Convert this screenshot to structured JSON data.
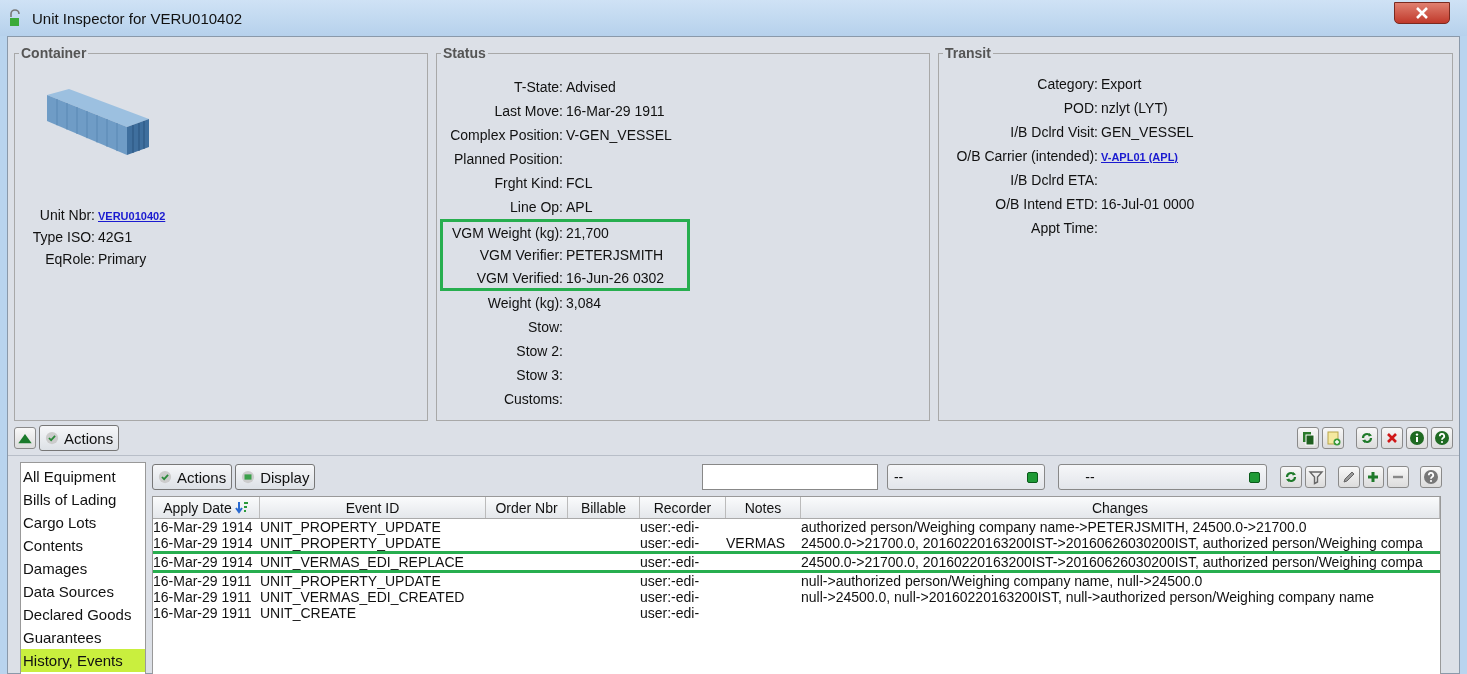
{
  "window": {
    "title": "Unit Inspector for VERU010402"
  },
  "container": {
    "title": "Container",
    "fields": [
      {
        "label": "Unit Nbr:",
        "value": "VERU010402",
        "kind": "link"
      },
      {
        "label": "Type ISO:",
        "value": "42G1",
        "kind": "text"
      },
      {
        "label": "EqRole:",
        "value": "Primary",
        "kind": "text"
      }
    ]
  },
  "status": {
    "title": "Status",
    "fields": [
      {
        "label": "T-State:",
        "value": "Advised",
        "highlighted": false
      },
      {
        "label": "Last Move:",
        "value": "16-Mar-29 1911",
        "highlighted": false
      },
      {
        "label": "Complex Position:",
        "value": "V-GEN_VESSEL",
        "highlighted": false
      },
      {
        "label": "Planned Position:",
        "highlighted": false
      },
      {
        "label": "Frght Kind:",
        "value": "FCL",
        "highlighted": false
      },
      {
        "label": "Line Op:",
        "value": "APL",
        "highlighted": false
      },
      {
        "label": "VGM Weight (kg):",
        "value": "21,700",
        "highlighted": true
      },
      {
        "label": "VGM Verifier:",
        "value": "PETERJSMITH",
        "highlighted": true
      },
      {
        "label": "VGM Verified:",
        "value": "16-Jun-26 0302",
        "highlighted": true
      },
      {
        "label": "Weight (kg):",
        "value": "3,084",
        "highlighted": false
      },
      {
        "label": "Stow:",
        "highlighted": false
      },
      {
        "label": "Stow 2:",
        "highlighted": false
      },
      {
        "label": "Stow 3:",
        "highlighted": false
      },
      {
        "label": "Customs:",
        "highlighted": false
      }
    ]
  },
  "transit": {
    "title": "Transit",
    "fields": [
      {
        "label": "Category:",
        "value": "Export",
        "kind": "text"
      },
      {
        "label": "POD:",
        "value": "nzlyt (LYT)",
        "kind": "text"
      },
      {
        "label": "I/B Dclrd Visit:",
        "value": "GEN_VESSEL",
        "kind": "text"
      },
      {
        "label": "O/B Carrier (intended):",
        "value": "V-APL01 (APL)",
        "kind": "link"
      },
      {
        "label": "I/B Dclrd ETA:"
      },
      {
        "label": "O/B Intend ETD:",
        "value": "16-Jul-01 0000",
        "kind": "text"
      },
      {
        "label": "Appt Time:"
      }
    ]
  },
  "toolbar": {
    "actions": "Actions"
  },
  "sidebar": {
    "items": [
      {
        "label": "All Equipment",
        "selected": false
      },
      {
        "label": "Bills of Lading",
        "selected": false
      },
      {
        "label": "Cargo Lots",
        "selected": false
      },
      {
        "label": "Contents",
        "selected": false
      },
      {
        "label": "Damages",
        "selected": false
      },
      {
        "label": "Data Sources",
        "selected": false
      },
      {
        "label": "Declared Goods",
        "selected": false
      },
      {
        "label": "Guarantees",
        "selected": false
      },
      {
        "label": "History, Events",
        "selected": true
      }
    ]
  },
  "events_toolbar": {
    "actions": "Actions",
    "display": "Display",
    "dropdowns": [
      "--",
      "--"
    ]
  },
  "table": {
    "columns": [
      {
        "label": "Apply Date",
        "sorted": true
      },
      {
        "label": "Event ID",
        "sorted": false
      },
      {
        "label": "Order Nbr",
        "sorted": false
      },
      {
        "label": "Billable",
        "sorted": false
      },
      {
        "label": "Recorder",
        "sorted": false
      },
      {
        "label": "Notes",
        "sorted": false
      },
      {
        "label": "Changes",
        "sorted": false
      }
    ],
    "rows": [
      {
        "highlighted": false,
        "apply_date": "16-Mar-29 1914",
        "event_id": "UNIT_PROPERTY_UPDATE",
        "recorder": "user:-edi-",
        "changes": "authorized person/Weighing company name->PETERJSMITH, 24500.0->21700.0"
      },
      {
        "highlighted": false,
        "apply_date": "16-Mar-29 1914",
        "event_id": "UNIT_PROPERTY_UPDATE",
        "recorder": "user:-edi-",
        "notes": "VERMAS",
        "changes": "24500.0->21700.0, 20160220163200IST->20160626030200IST, authorized person/Weighing compa"
      },
      {
        "highlighted": true,
        "apply_date": "16-Mar-29 1914",
        "event_id": "UNIT_VERMAS_EDI_REPLACE",
        "recorder": "user:-edi-",
        "changes": "24500.0->21700.0, 20160220163200IST->20160626030200IST, authorized person/Weighing compa"
      },
      {
        "highlighted": false,
        "apply_date": "16-Mar-29 1911",
        "event_id": "UNIT_PROPERTY_UPDATE",
        "recorder": "user:-edi-",
        "changes": "null->authorized person/Weighing company name, null->24500.0"
      },
      {
        "highlighted": false,
        "apply_date": "16-Mar-29 1911",
        "event_id": "UNIT_VERMAS_EDI_CREATED",
        "recorder": "user:-edi-",
        "changes": "null->24500.0, null->20160220163200IST, null->authorized person/Weighing company name"
      },
      {
        "highlighted": false,
        "apply_date": "16-Mar-29 1911",
        "event_id": "UNIT_CREATE",
        "recorder": "user:-edi-"
      }
    ]
  }
}
